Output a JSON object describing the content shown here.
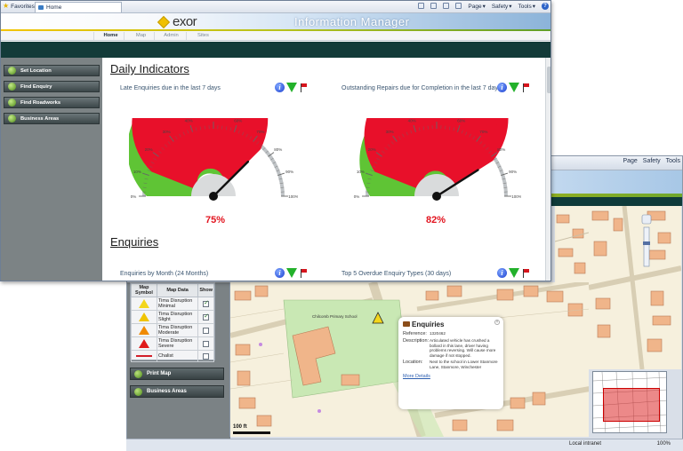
{
  "ie": {
    "favorites": "Favorites",
    "tab": "Home",
    "tools": [
      "Page",
      "Safety",
      "Tools"
    ],
    "help": "?"
  },
  "app": {
    "logo": "exor",
    "title": "Information Manager"
  },
  "nav": [
    "Home",
    "Map",
    "Admin",
    "Sites"
  ],
  "sidebar": [
    "Set Location",
    "Find Enquiry",
    "Find Roadworks",
    "Business Areas"
  ],
  "daily": {
    "title": "Daily Indicators",
    "gauge1": {
      "label": "Late Enquiries due in the last 7 days",
      "value": 75,
      "display": "75%"
    },
    "gauge2": {
      "label": "Outstanding Repairs due for Completion in the last 7 days",
      "value": 82,
      "display": "82%"
    },
    "ticks": [
      "0%",
      "10%",
      "20%",
      "30%",
      "40%",
      "50%",
      "60%",
      "70%",
      "80%",
      "90%",
      "100%"
    ],
    "colors": {
      "red": "#e8102a",
      "green": "#5fc435"
    }
  },
  "enquiries": {
    "title": "Enquiries",
    "left_label": "Enquiries by Month (24 Months)",
    "right_label": "Top 5 Overdue Enquiry Types (30 days)"
  },
  "legend": {
    "headers": [
      "Map Symbol",
      "Map Data",
      "Show"
    ],
    "rows": [
      {
        "label": "Tima Disruption Minimal",
        "show": true
      },
      {
        "label": "Tima Disruption Slight",
        "show": true
      },
      {
        "label": "Tima Disruption Moderate",
        "show": false
      },
      {
        "label": "Tima Disruption Severe",
        "show": false
      },
      {
        "label": "Chalist",
        "show": false
      }
    ]
  },
  "back_buttons": [
    "Print Map",
    "Business Areas"
  ],
  "popup": {
    "title": "Enquiries",
    "reference_label": "Reference:",
    "reference": "1320462",
    "description_label": "Description:",
    "description": "Articulated vehicle has crushed a bollard in this lane, driver having problems reversing. Will cause more damage if not stopped.",
    "location_label": "Location:",
    "location": "Next to the school in Lower Stanmore Lane, Stanmore, Winchester",
    "more": "More Details"
  },
  "map": {
    "label": "Chilcomb Primary School",
    "scale": "100 ft"
  },
  "status": {
    "zone": "Local intranet",
    "zoom": "100%"
  }
}
